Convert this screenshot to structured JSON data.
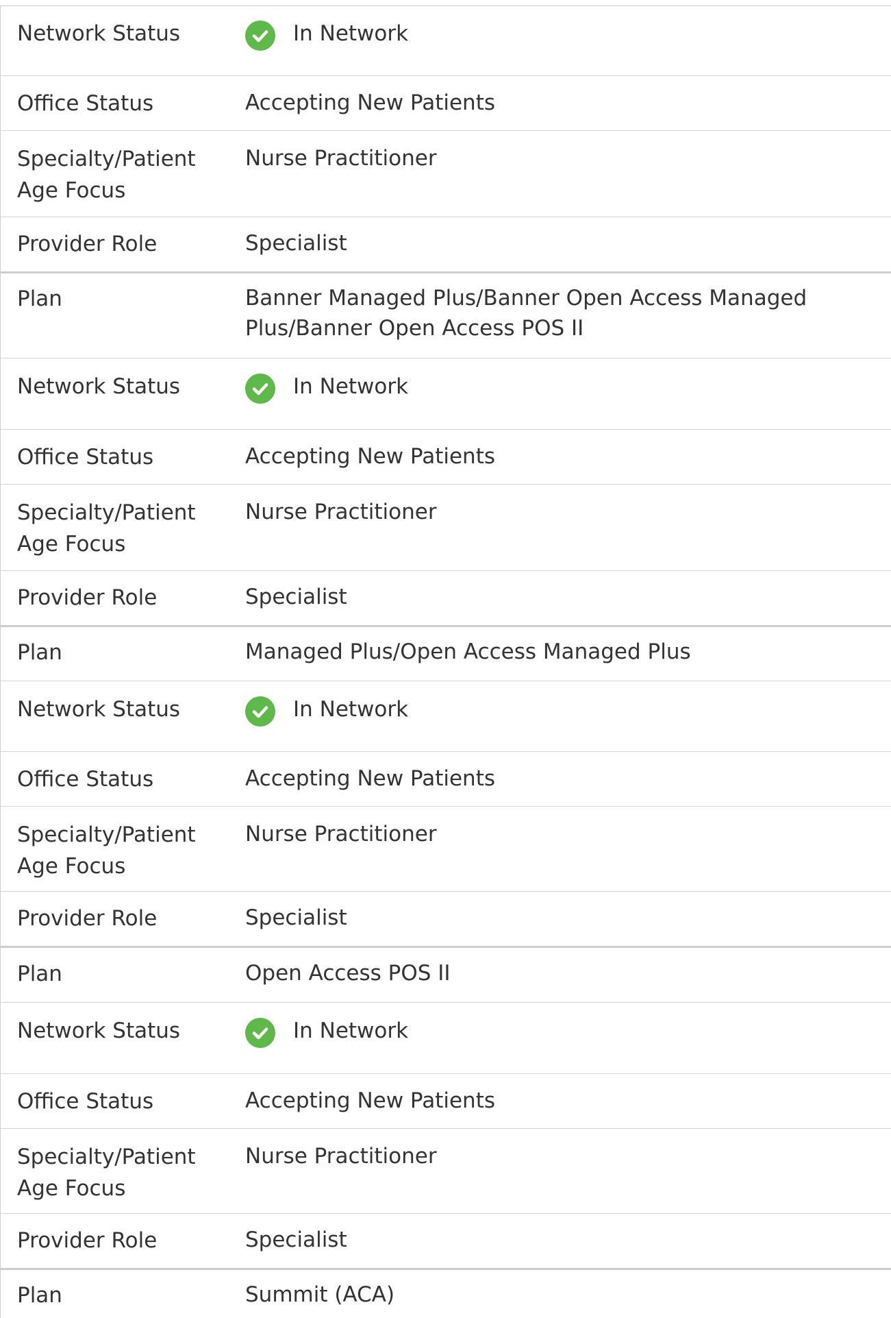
{
  "rows": [
    {
      "label": "Network Status",
      "value": "In Network",
      "icon": "check-circle-icon",
      "icon_color": "#5fb84a"
    },
    {
      "label": "Office Status",
      "value": "Accepting New Patients"
    },
    {
      "label": "Specialty/Patient Age Focus",
      "value": "Nurse Practitioner"
    },
    {
      "label": "Provider Role",
      "value": "Specialist"
    },
    {
      "label": "Plan",
      "value": "Banner Managed Plus/Banner Open Access Managed Plus/Banner Open Access POS II"
    },
    {
      "label": "Network Status",
      "value": "In Network",
      "icon": "check-circle-icon",
      "icon_color": "#5fb84a"
    },
    {
      "label": "Office Status",
      "value": "Accepting New Patients"
    },
    {
      "label": "Specialty/Patient Age Focus",
      "value": "Nurse Practitioner"
    },
    {
      "label": "Provider Role",
      "value": "Specialist"
    },
    {
      "label": "Plan",
      "value": "Managed Plus/Open Access Managed Plus"
    },
    {
      "label": "Network Status",
      "value": "In Network",
      "icon": "check-circle-icon",
      "icon_color": "#5fb84a"
    },
    {
      "label": "Office Status",
      "value": "Accepting New Patients"
    },
    {
      "label": "Specialty/Patient Age Focus",
      "value": "Nurse Practitioner"
    },
    {
      "label": "Provider Role",
      "value": "Specialist"
    },
    {
      "label": "Plan",
      "value": "Open Access POS II"
    },
    {
      "label": "Network Status",
      "value": "In Network",
      "icon": "check-circle-icon",
      "icon_color": "#5fb84a"
    },
    {
      "label": "Office Status",
      "value": "Accepting New Patients"
    },
    {
      "label": "Specialty/Patient Age Focus",
      "value": "Nurse Practitioner"
    },
    {
      "label": "Provider Role",
      "value": "Specialist"
    },
    {
      "label": "Plan",
      "value": "Summit (ACA)"
    }
  ]
}
